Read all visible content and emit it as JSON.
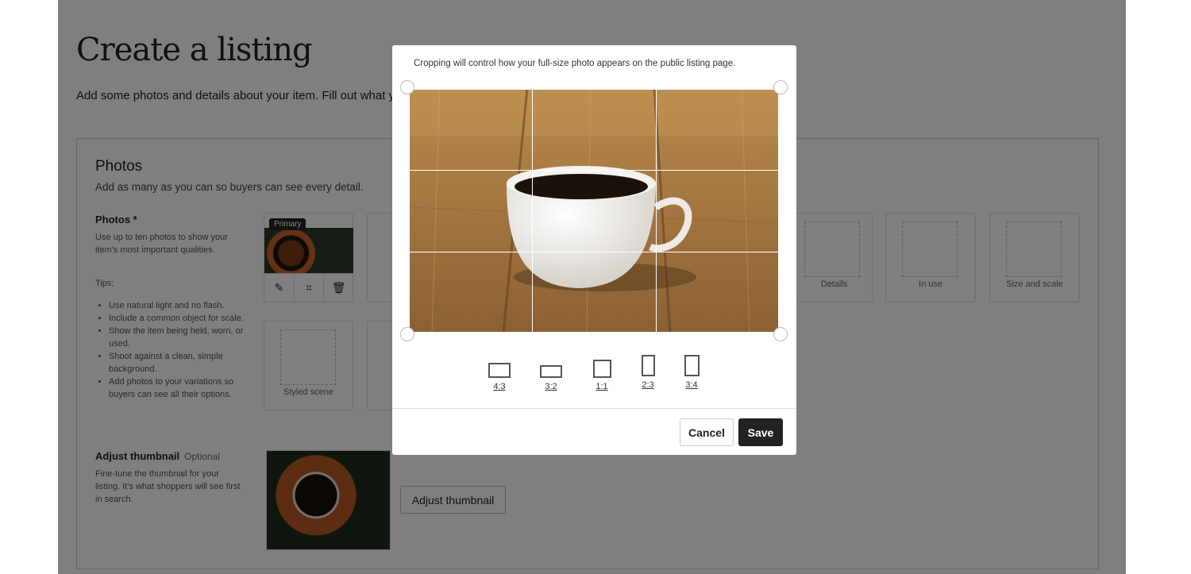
{
  "page": {
    "title": "Create a listing",
    "subtitle": "Add some photos and details about your item. Fill out what you can for now—you'll be able to edit this later."
  },
  "photos": {
    "heading": "Photos",
    "subheading": "Add as many as you can so buyers can see every detail.",
    "field_label": "Photos *",
    "field_desc": "Use up to ten photos to show your item's most important qualities.",
    "tips_label": "Tips:",
    "tips": [
      "Use natural light and no flash.",
      "Include a common object for scale.",
      "Show the item being held, worn, or used.",
      "Shoot against a clean, simple background.",
      "Add photos to your variations so buyers can see all their options."
    ],
    "primary_badge": "Primary",
    "slots": [
      "Styled scene",
      "Details",
      "In use",
      "Size and scale"
    ]
  },
  "thumbnail": {
    "label": "Adjust thumbnail",
    "optional": "Optional",
    "desc": "Fine-tune the thumbnail for your listing. It's what shoppers will see first in search.",
    "button": "Adjust thumbnail"
  },
  "modal": {
    "note": "Cropping will control how your full-size photo appears on the public listing page.",
    "ratios": [
      "4:3",
      "3:2",
      "1:1",
      "2:3",
      "3:4"
    ],
    "cancel": "Cancel",
    "save": "Save"
  },
  "colors": {
    "overlay": "#00000080",
    "primary_button": "#222222",
    "wood": "#a97a3e"
  },
  "icons": [
    "pencil-icon",
    "crop-icon",
    "trash-icon"
  ]
}
